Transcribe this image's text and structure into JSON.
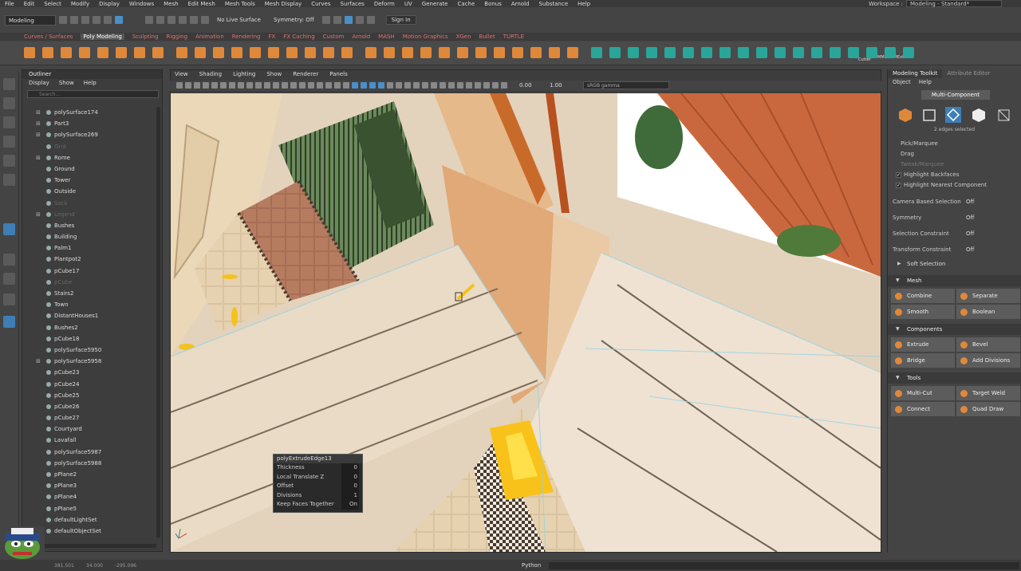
{
  "menubar": {
    "items": [
      "File",
      "Edit",
      "Select",
      "Modify",
      "Display",
      "Windows",
      "Mesh",
      "Edit Mesh",
      "Mesh Tools",
      "Mesh Display",
      "Curves",
      "Surfaces",
      "Deform",
      "UV",
      "Generate",
      "Cache",
      "Bonus",
      "Arnold",
      "Substance",
      "Help"
    ],
    "workspace_label": "Workspace :",
    "workspace_value": "Modeling - Standard*"
  },
  "statusline": {
    "mode": "Modeling",
    "live_surface": "No Live Surface",
    "symmetry": "Symmetry: Off",
    "sign_in": "Sign In"
  },
  "shelf": {
    "tabs": [
      "Curves / Surfaces",
      "Poly Modeling",
      "Sculpting",
      "Rigging",
      "Animation",
      "Rendering",
      "FX",
      "FX Caching",
      "Custom",
      "Arnold",
      "MASH",
      "Motion Graphics",
      "XGen",
      "Bullet",
      "TURTLE"
    ],
    "active_tab": "Poly Modeling",
    "cutter_label": "Cutter",
    "mirror_label": "MMirror MExtrude"
  },
  "outliner": {
    "title": "Outliner",
    "menu": [
      "Display",
      "Show",
      "Help"
    ],
    "search_placeholder": "Search...",
    "items": [
      {
        "label": "polySurface174",
        "expand": true,
        "dim": false
      },
      {
        "label": "Part3",
        "expand": true,
        "dim": false
      },
      {
        "label": "polySurface269",
        "expand": true,
        "dim": false
      },
      {
        "label": "Grid",
        "expand": false,
        "dim": true
      },
      {
        "label": "Rome",
        "expand": true,
        "dim": false
      },
      {
        "label": "Ground",
        "expand": false,
        "dim": false
      },
      {
        "label": "Tower",
        "expand": false,
        "dim": false
      },
      {
        "label": "Outside",
        "expand": false,
        "dim": false
      },
      {
        "label": "Sock",
        "expand": false,
        "dim": true
      },
      {
        "label": "Legend",
        "expand": true,
        "dim": true
      },
      {
        "label": "Bushes",
        "expand": false,
        "dim": false
      },
      {
        "label": "Building",
        "expand": false,
        "dim": false
      },
      {
        "label": "Palm1",
        "expand": false,
        "dim": false
      },
      {
        "label": "Plantpot2",
        "expand": false,
        "dim": false
      },
      {
        "label": "pCube17",
        "expand": false,
        "dim": false
      },
      {
        "label": "pCube",
        "expand": false,
        "dim": true
      },
      {
        "label": "Stairs2",
        "expand": false,
        "dim": false
      },
      {
        "label": "Town",
        "expand": false,
        "dim": false
      },
      {
        "label": "DistantHouses1",
        "expand": false,
        "dim": false
      },
      {
        "label": "Bushes2",
        "expand": false,
        "dim": false
      },
      {
        "label": "pCube18",
        "expand": false,
        "dim": false
      },
      {
        "label": "polySurface5950",
        "expand": false,
        "dim": false
      },
      {
        "label": "polySurface5958",
        "expand": true,
        "dim": false
      },
      {
        "label": "pCube23",
        "expand": false,
        "dim": false
      },
      {
        "label": "pCube24",
        "expand": false,
        "dim": false
      },
      {
        "label": "pCube25",
        "expand": false,
        "dim": false
      },
      {
        "label": "pCube26",
        "expand": false,
        "dim": false
      },
      {
        "label": "pCube27",
        "expand": false,
        "dim": false
      },
      {
        "label": "Courtyard",
        "expand": false,
        "dim": false
      },
      {
        "label": "Lavafall",
        "expand": false,
        "dim": false
      },
      {
        "label": "polySurface5987",
        "expand": false,
        "dim": false
      },
      {
        "label": "polySurface5988",
        "expand": false,
        "dim": false
      },
      {
        "label": "pPlane2",
        "expand": false,
        "dim": false
      },
      {
        "label": "pPlane3",
        "expand": false,
        "dim": false
      },
      {
        "label": "pPlane4",
        "expand": false,
        "dim": false
      },
      {
        "label": "pPlane5",
        "expand": false,
        "dim": false
      },
      {
        "label": "defaultLightSet",
        "expand": false,
        "dim": false
      },
      {
        "label": "defaultObjectSet",
        "expand": false,
        "dim": false
      }
    ]
  },
  "viewport": {
    "menu": [
      "View",
      "Shading",
      "Lighting",
      "Show",
      "Renderer",
      "Panels"
    ],
    "exposure": "0.00",
    "gamma": "1.00",
    "colorspace": "sRGB gamma",
    "attr_box": {
      "title": "polyExtrudeEdge13",
      "rows": [
        {
          "label": "Thickness",
          "value": "0"
        },
        {
          "label": "Local Translate Z",
          "value": "0"
        },
        {
          "label": "Offset",
          "value": "0"
        },
        {
          "label": "Divisions",
          "value": "1"
        },
        {
          "label": "Keep Faces Together",
          "value": "On"
        }
      ]
    }
  },
  "toolkit": {
    "tab_active": "Modeling Toolkit",
    "tab_other": "Attribute Editor",
    "menu": [
      "Object",
      "Help"
    ],
    "multi_component": "Multi-Component",
    "selection_info": "2 edges selected",
    "pick_marquee": "Pick/Marquee",
    "drag": "Drag",
    "tweak_marquee": "Tweak/Marquee",
    "highlight_backfaces": "Highlight Backfaces",
    "highlight_nearest": "Highlight Nearest Component",
    "options": [
      {
        "label": "Camera Based Selection",
        "value": "Off"
      },
      {
        "label": "Symmetry",
        "value": "Off"
      },
      {
        "label": "Selection Constraint",
        "value": "Off"
      },
      {
        "label": "Transform Constraint",
        "value": "Off"
      }
    ],
    "soft_selection": "Soft Selection",
    "mesh_title": "Mesh",
    "mesh_buttons": [
      "Combine",
      "Separate",
      "Smooth",
      "Boolean"
    ],
    "components_title": "Components",
    "component_buttons": [
      "Extrude",
      "Bevel",
      "Bridge",
      "Add Divisions"
    ],
    "tools_title": "Tools",
    "tool_buttons": [
      "Multi-Cut",
      "Target Weld",
      "Connect",
      "Quad Draw"
    ]
  },
  "bottom": {
    "coord_x": "381.501",
    "coord_y": "34.000",
    "coord_z": "-295.096",
    "python_label": "Python"
  },
  "colors": {
    "accent_blue": "#3e7eb5",
    "shelf_orange": "#e0883a",
    "shelf_teal": "#2aa59a"
  }
}
